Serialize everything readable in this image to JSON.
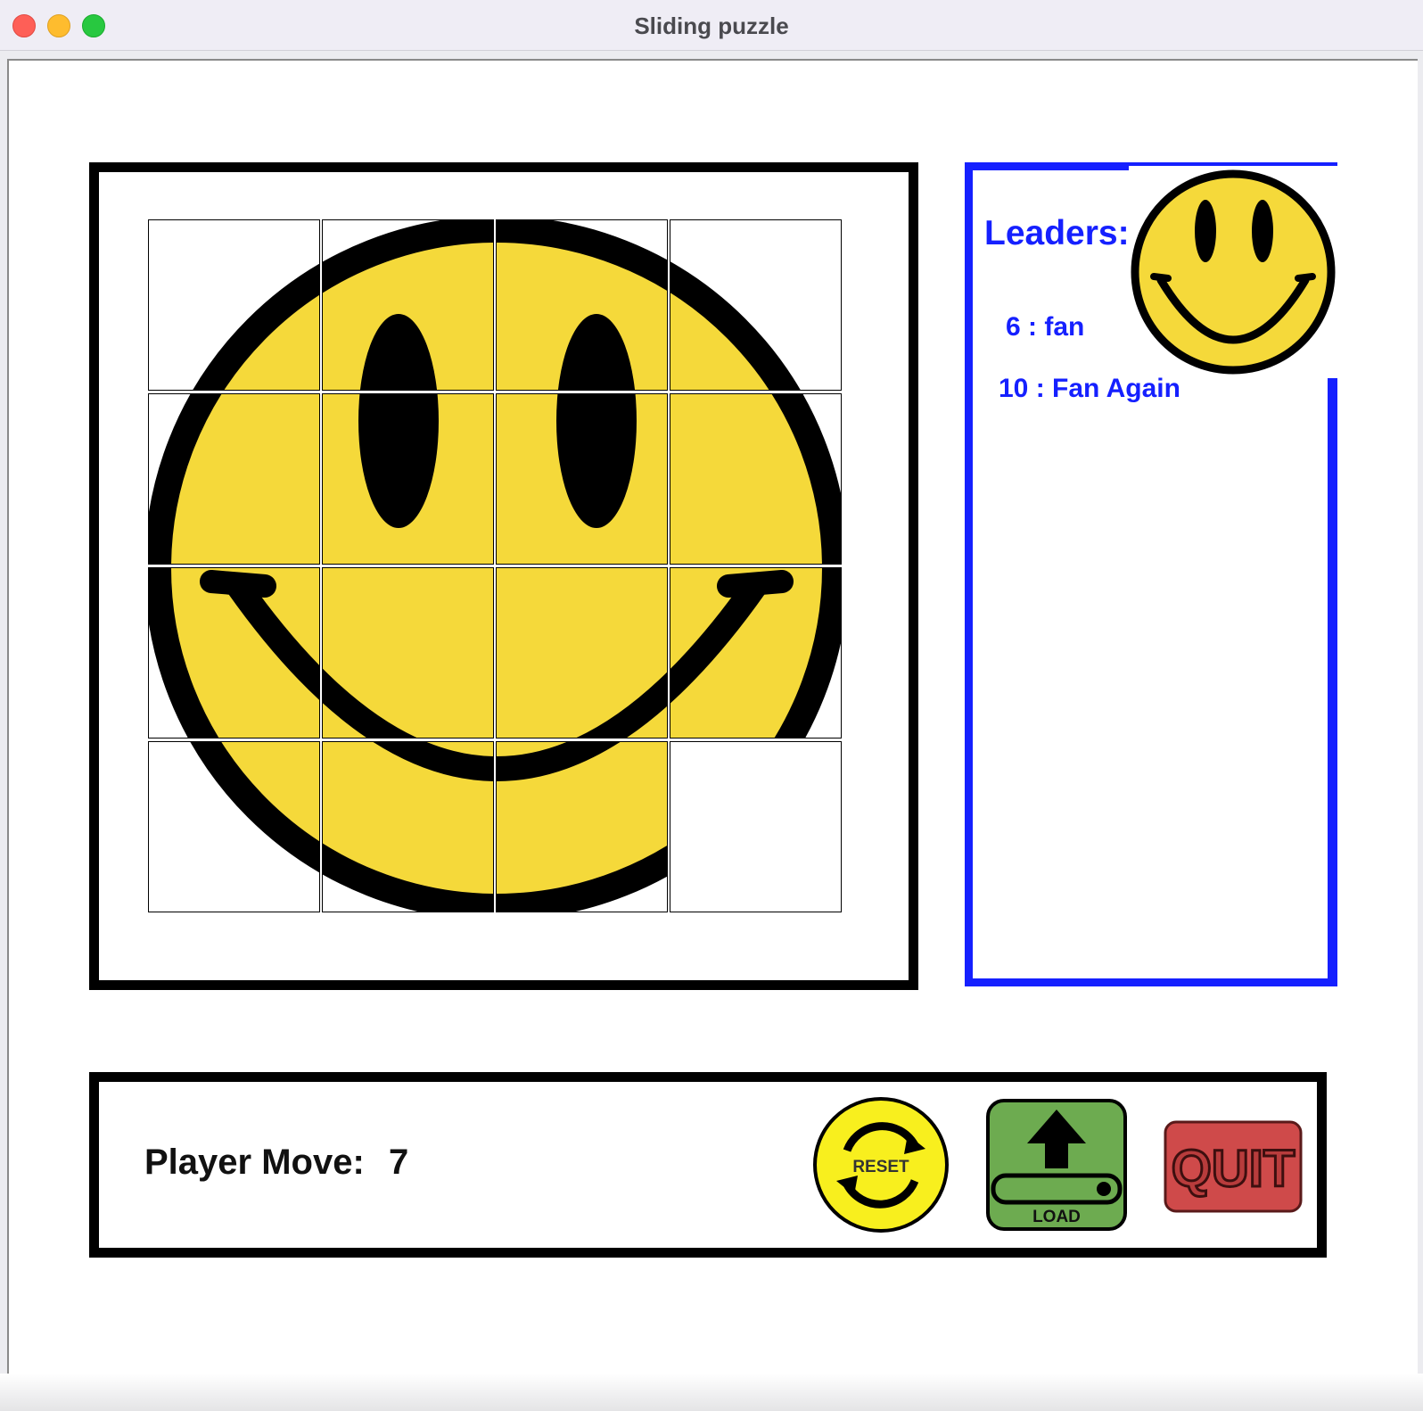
{
  "window": {
    "title": "Sliding puzzle"
  },
  "leaderboard": {
    "title": "Leaders:",
    "entries": [
      "6 : fan",
      "10 : Fan Again"
    ]
  },
  "controls": {
    "player_move_label": "Player Move:",
    "player_move_value": "7",
    "reset_label": "RESET",
    "load_label": "LOAD",
    "quit_label": "QUIT"
  },
  "puzzle": {
    "grid": "4x4",
    "empty_tile": "row 4, column 4"
  },
  "colors": {
    "face_yellow": "#f5d93a",
    "leader_blue": "#1520ff",
    "load_green": "#6dab50",
    "quit_red": "#cf4a4a"
  }
}
